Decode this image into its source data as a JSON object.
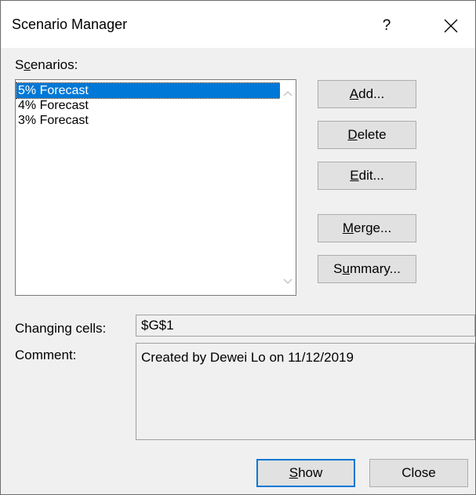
{
  "dialog": {
    "title": "Scenario Manager",
    "help_label": "?"
  },
  "scenarios": {
    "label_pre": "S",
    "label_mnemonic": "c",
    "label_post": "enarios:",
    "items": [
      {
        "label": "5% Forecast",
        "selected": true
      },
      {
        "label": "4% Forecast",
        "selected": false
      },
      {
        "label": "3% Forecast",
        "selected": false
      }
    ]
  },
  "buttons": {
    "add": {
      "mnemonic": "A",
      "rest": "dd..."
    },
    "delete": {
      "mnemonic": "D",
      "rest": "elete"
    },
    "edit": {
      "mnemonic": "E",
      "rest": "dit..."
    },
    "merge": {
      "mnemonic": "M",
      "rest": "erge..."
    },
    "summary": {
      "pre": "S",
      "mnemonic": "u",
      "rest": "mmary..."
    },
    "show": {
      "mnemonic": "S",
      "rest": "how"
    },
    "close": "Close"
  },
  "changing_cells": {
    "label": "Changing cells:",
    "value": "$G$1"
  },
  "comment": {
    "label": "Comment:",
    "value": "Created by Dewei Lo on 11/12/2019"
  },
  "colors": {
    "accent": "#0078d7",
    "dialog_bg": "#f0f0f0",
    "button_bg": "#e1e1e1"
  },
  "icons": {
    "close": "close-icon",
    "scroll_up": "chevron-up-icon",
    "scroll_down": "chevron-down-icon"
  }
}
